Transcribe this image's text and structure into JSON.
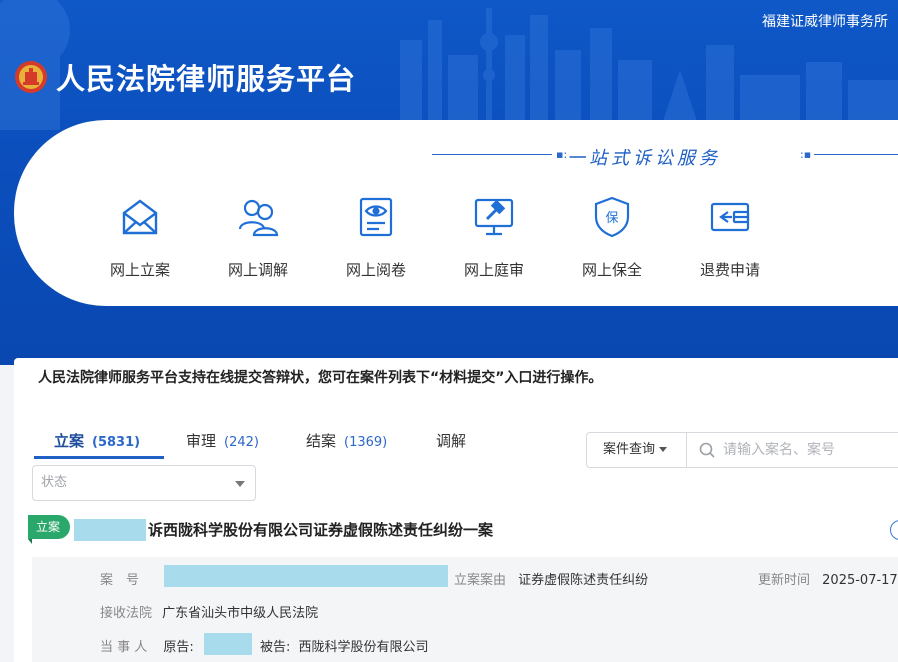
{
  "header": {
    "firm_name": "福建证威律师事务所",
    "title": "人民法院律师服务平台",
    "tagline": "一站式诉讼服务"
  },
  "services": [
    {
      "label": "网上立案",
      "icon": "envelope-icon"
    },
    {
      "label": "网上调解",
      "icon": "people-icon"
    },
    {
      "label": "网上阅卷",
      "icon": "document-eye-icon"
    },
    {
      "label": "网上庭审",
      "icon": "gavel-monitor-icon"
    },
    {
      "label": "网上保全",
      "icon": "shield-icon"
    },
    {
      "label": "退费申请",
      "icon": "wallet-refund-icon"
    }
  ],
  "notice": "人民法院律师服务平台支持在线提交答辩状，您可在案件列表下“材料提交”入口进行操作。",
  "tabs": [
    {
      "label": "立案",
      "count": "(5831)",
      "active": true
    },
    {
      "label": "审理",
      "count": "(242)",
      "active": false
    },
    {
      "label": "结案",
      "count": "(1369)",
      "active": false
    },
    {
      "label": "调解",
      "count": "",
      "active": false
    }
  ],
  "search": {
    "type_label": "案件查询",
    "placeholder": "请输入案名、案号"
  },
  "filter": {
    "status_placeholder": "状态"
  },
  "case": {
    "badge": "立案",
    "title": "诉西陇科学股份有限公司证券虚假陈述责任纠纷一案",
    "case_no_label": "案　号",
    "cause_label": "立案案由",
    "cause_value": "证券虚假陈述责任纠纷",
    "updated_label": "更新时间",
    "updated_value": "2025-07-17",
    "court_label": "接收法院",
    "court_value": "广东省汕头市中级人民法院",
    "parties_label": "当 事 人",
    "plaintiff_label": "原告:",
    "defendant_label": "被告:",
    "defendant_value": "西陇科学股份有限公司"
  },
  "colors": {
    "brand_blue": "#0b4fbd",
    "accent_blue": "#1f5fc6",
    "badge_green": "#2aa86b",
    "redaction": "#a8dcec"
  }
}
